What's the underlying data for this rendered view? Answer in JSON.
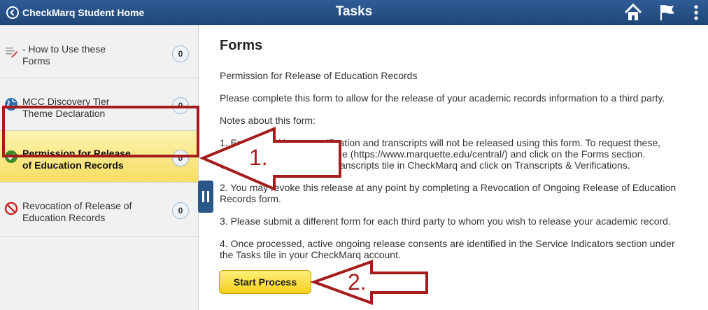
{
  "header": {
    "back_label": "CheckMarq Student Home",
    "title": "Tasks",
    "bg_color": "#2f5c96"
  },
  "sidebar": {
    "items": [
      {
        "label_line1": "- How to Use these",
        "label_line2": "Forms",
        "count": "0",
        "icon": "document-pencil-icon",
        "active": false
      },
      {
        "label_line1": "MCC Discovery Tier",
        "label_line2": "Theme Declaration",
        "count": "0",
        "icon": "globe-icon",
        "active": false
      },
      {
        "label_line1": "Permission for Release",
        "label_line2": "of Education Records",
        "count": "0",
        "icon": "green-check-icon",
        "active": true
      },
      {
        "label_line1": "Revocation of Release of",
        "label_line2": "Education Records",
        "count": "0",
        "icon": "prohibited-icon",
        "active": false
      }
    ]
  },
  "main": {
    "heading": "Forms",
    "form_name": "Permission for Release of Education Records",
    "intro": "Please complete this form to allow for the release of your academic records information to a third party.",
    "notes_heading": "Notes about this form:",
    "note1_line1": "1.  Enrollment/degree verification and transcripts will not be released using this form. To request these,",
    "note1_line2": "visit the MU Central webpage (https://www.marquette.edu/central/) and click on the Forms section.",
    "note1_line3": "Or, click on the Grades & Transcripts tile in CheckMarq and click on Transcripts & Verifications.",
    "note2_line1": "2.  You may revoke this release at any point by completing a Revocation of Ongoing Release of Education",
    "note2_line2": "Records form.",
    "note3": "3.  Please submit a different form for each third party to whom you wish to release your academic record.",
    "note4_line1": "4.  Once processed, active ongoing release consents are identified in the Service Indicators section under",
    "note4_line2": "the Tasks tile in your CheckMarq account.",
    "start_button": "Start Process"
  },
  "annotations": {
    "arrow1_label": "1.",
    "arrow2_label": "2.",
    "color": "#a51c1c"
  }
}
